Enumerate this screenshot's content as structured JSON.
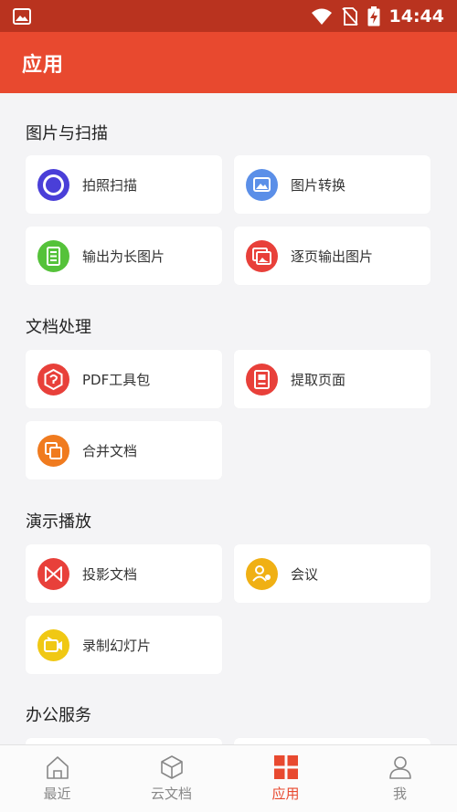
{
  "status_bar": {
    "time": "14:44",
    "icons": [
      "image-icon",
      "wifi-icon",
      "no-sim-icon",
      "battery-charging-icon"
    ]
  },
  "header": {
    "title": "应用"
  },
  "sections": [
    {
      "title": "图片与扫描",
      "items": [
        {
          "label": "拍照扫描",
          "icon": "camera-scan-icon",
          "color": "#4a3fd8"
        },
        {
          "label": "图片转换",
          "icon": "image-convert-icon",
          "color": "#5b8fe8"
        },
        {
          "label": "输出为长图片",
          "icon": "long-image-icon",
          "color": "#55c23a"
        },
        {
          "label": "逐页输出图片",
          "icon": "page-image-icon",
          "color": "#e8403a"
        }
      ]
    },
    {
      "title": "文档处理",
      "items": [
        {
          "label": "PDF工具包",
          "icon": "pdf-toolkit-icon",
          "color": "#e8403a"
        },
        {
          "label": "提取页面",
          "icon": "extract-page-icon",
          "color": "#e8403a"
        },
        {
          "label": "合并文档",
          "icon": "merge-doc-icon",
          "color": "#f07b1f"
        }
      ]
    },
    {
      "title": "演示播放",
      "items": [
        {
          "label": "投影文档",
          "icon": "project-doc-icon",
          "color": "#e8403a"
        },
        {
          "label": "会议",
          "icon": "meeting-icon",
          "color": "#f0b014"
        },
        {
          "label": "录制幻灯片",
          "icon": "record-slides-icon",
          "color": "#f0c814"
        }
      ]
    },
    {
      "title": "办公服务",
      "items": []
    }
  ],
  "bottom_nav": [
    {
      "label": "最近",
      "icon": "home-icon",
      "active": false
    },
    {
      "label": "云文档",
      "icon": "cloud-box-icon",
      "active": false
    },
    {
      "label": "应用",
      "icon": "apps-grid-icon",
      "active": true
    },
    {
      "label": "我",
      "icon": "profile-icon",
      "active": false
    }
  ],
  "colors": {
    "status_bar": "#b9331f",
    "app_bar": "#e8492f",
    "accent": "#e8492f",
    "background": "#f4f4f6"
  }
}
